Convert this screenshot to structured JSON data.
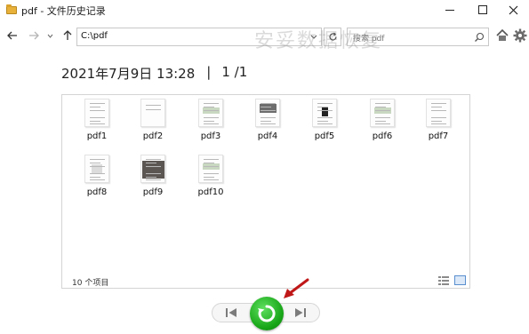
{
  "window": {
    "title": "pdf - 文件历史记录"
  },
  "toolbar": {
    "address_value": "C:\\pdf",
    "search_placeholder": "搜索 pdf"
  },
  "watermark": "安妥数据恢复",
  "header": {
    "date": "2021年7月9日 13:28",
    "separator": "|",
    "page": "1 /1"
  },
  "files": [
    {
      "name": "pdf1",
      "thumb": "text"
    },
    {
      "name": "pdf2",
      "thumb": "text-light"
    },
    {
      "name": "pdf3",
      "thumb": "table"
    },
    {
      "name": "pdf4",
      "thumb": "photo"
    },
    {
      "name": "pdf5",
      "thumb": "dark-block"
    },
    {
      "name": "pdf6",
      "thumb": "table"
    },
    {
      "name": "pdf7",
      "thumb": "text"
    },
    {
      "name": "pdf8",
      "thumb": "diagram"
    },
    {
      "name": "pdf9",
      "thumb": "photo-dark"
    },
    {
      "name": "pdf10",
      "thumb": "table"
    }
  ],
  "status": {
    "count": "10 个项目"
  },
  "colors": {
    "restore_green": "#17a517",
    "annotation_red": "#c01818",
    "view_selected": "#5a8fcf"
  }
}
